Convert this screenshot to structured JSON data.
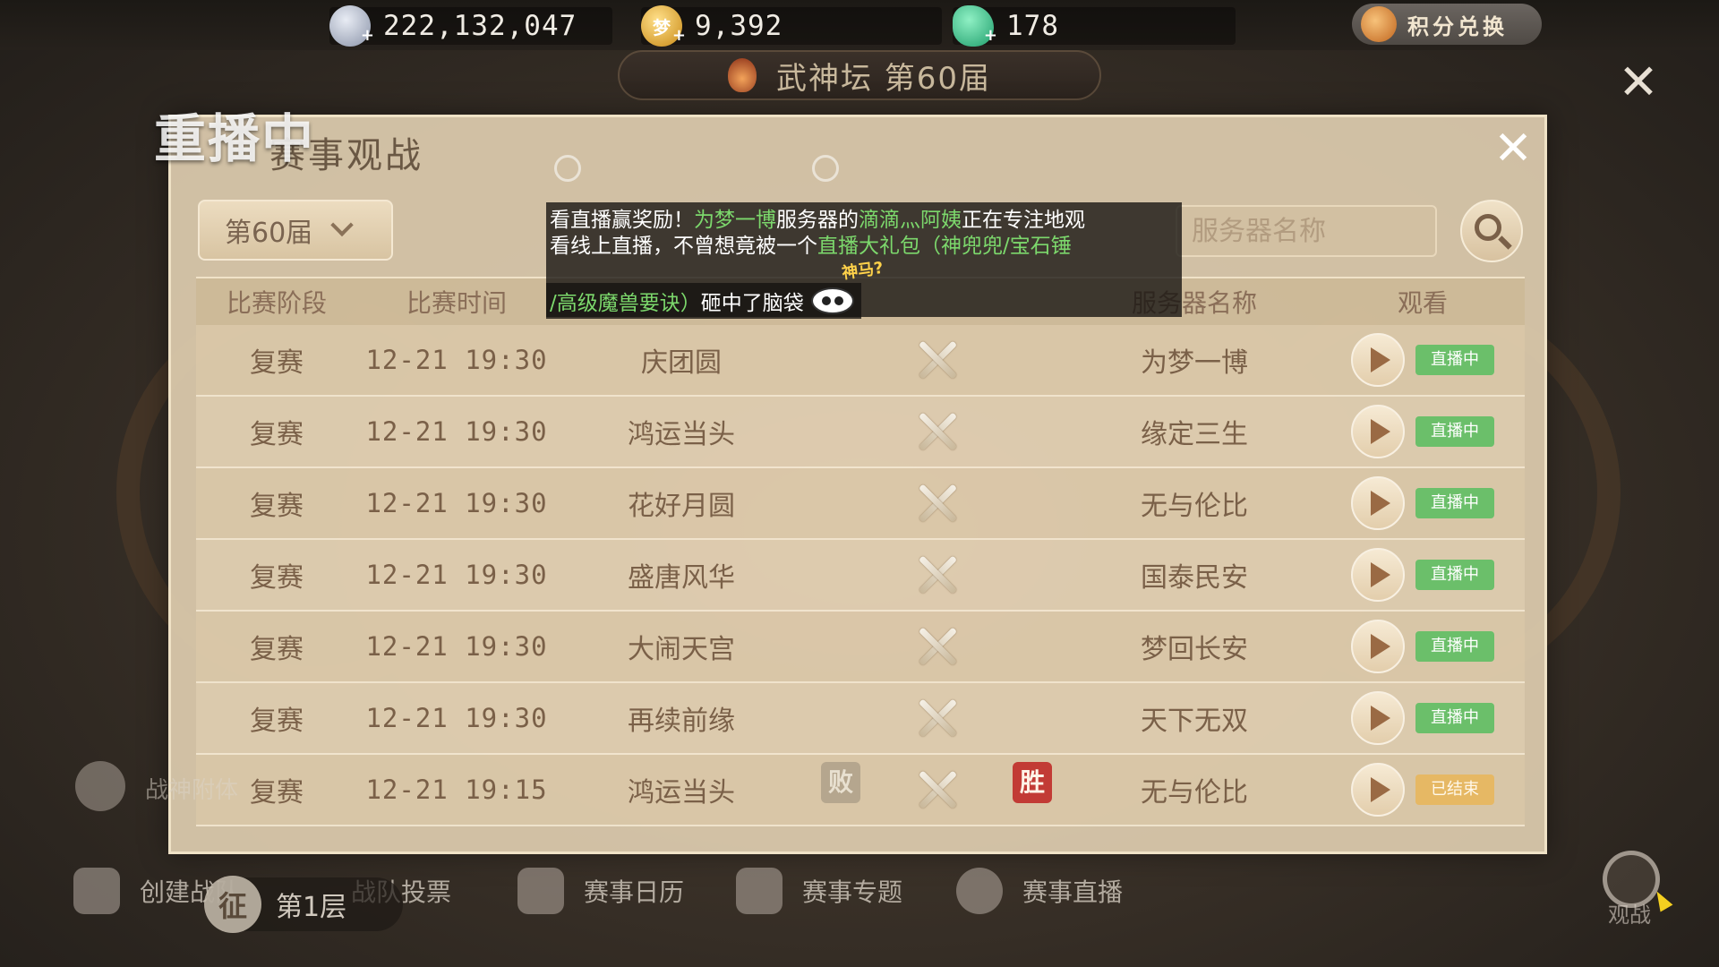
{
  "currencies": [
    {
      "icon": "silver-coin-icon",
      "value": "222,132,047"
    },
    {
      "icon": "dream-coin-icon",
      "glyph": "梦",
      "value": "9,392"
    },
    {
      "icon": "jade-icon",
      "value": "178"
    }
  ],
  "exchange_label": "积分兑换",
  "event_title": "武神坛 第60届",
  "replay_tag": "重播中",
  "panel": {
    "title": "赛事观战",
    "season": "第60届",
    "search_placeholder": "服务器名称"
  },
  "columns": [
    "比赛阶段",
    "比赛时间",
    "服务器名称",
    "观看"
  ],
  "notice": {
    "line1_a": "看直播赢奖励！",
    "line1_b": "为梦一博",
    "line1_c": "服务器的",
    "line1_d": "滴滴灬阿姨",
    "line1_e": "正在专注地观",
    "line2_a": "看线上直播，不曾想竟被一个",
    "line2_b": "直播大礼包（神兜兜/宝石锤",
    "line3_a": "/高级魔兽要诀）",
    "line3_b": "砸中了脑袋",
    "tag": "神马?"
  },
  "matches": [
    {
      "stage": "复赛",
      "time": "12-21 19:30",
      "server_a": "庆团圆",
      "server_b": "为梦一博",
      "status": "直播中",
      "state": "live"
    },
    {
      "stage": "复赛",
      "time": "12-21 19:30",
      "server_a": "鸿运当头",
      "server_b": "缘定三生",
      "status": "直播中",
      "state": "live"
    },
    {
      "stage": "复赛",
      "time": "12-21 19:30",
      "server_a": "花好月圆",
      "server_b": "无与伦比",
      "status": "直播中",
      "state": "live"
    },
    {
      "stage": "复赛",
      "time": "12-21 19:30",
      "server_a": "盛唐风华",
      "server_b": "国泰民安",
      "status": "直播中",
      "state": "live"
    },
    {
      "stage": "复赛",
      "time": "12-21 19:30",
      "server_a": "大闹天宫",
      "server_b": "梦回长安",
      "status": "直播中",
      "state": "live"
    },
    {
      "stage": "复赛",
      "time": "12-21 19:30",
      "server_a": "再续前缘",
      "server_b": "天下无双",
      "status": "直播中",
      "state": "live"
    },
    {
      "stage": "复赛",
      "time": "12-21 19:15",
      "server_a": "鸿运当头",
      "server_b": "无与伦比",
      "status": "已结束",
      "state": "ended",
      "result_a": "败",
      "result_b": "胜"
    }
  ],
  "bottom_nav": [
    {
      "label": "创建战队",
      "icon": "runner-icon"
    },
    {
      "label": "战队投票",
      "icon": "vote-icon"
    },
    {
      "label": "赛事日历",
      "icon": "calendar-icon"
    },
    {
      "label": "赛事专题",
      "icon": "scroll-icon"
    },
    {
      "label": "赛事直播",
      "icon": "live-icon"
    }
  ],
  "side_label": "战神附体",
  "conquest": {
    "badge": "征",
    "label": "第1层"
  },
  "watch_label": "观战",
  "colors": {
    "live": "#6bbf6a",
    "ended": "#e6b864",
    "win": "#c23b35",
    "lose": "#b5a68e"
  }
}
